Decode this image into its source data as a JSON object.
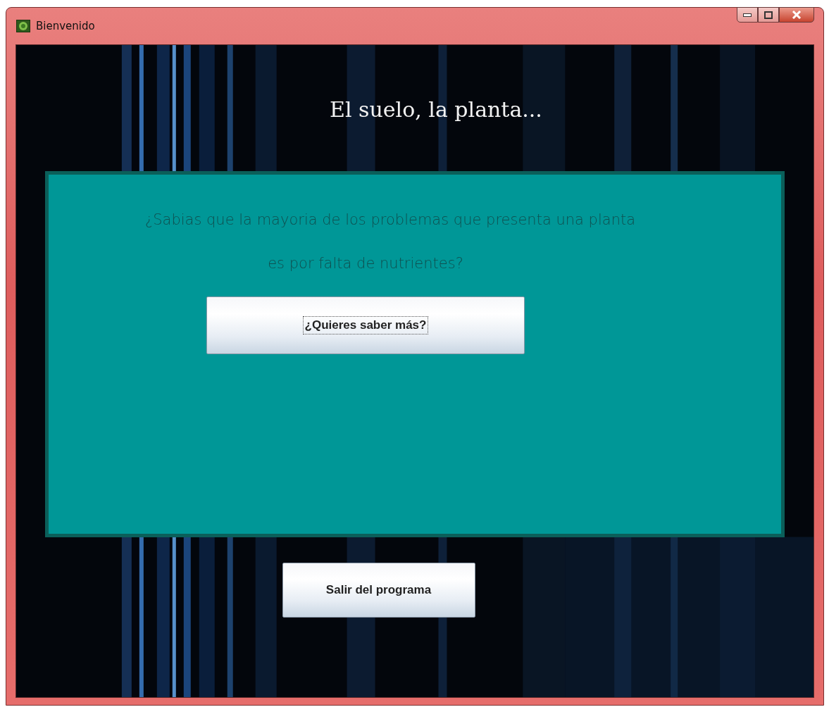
{
  "window": {
    "title": "Bienvenido"
  },
  "heading": "El suelo, la planta...",
  "panel": {
    "lines": [
      "¿Sabias que la mayoria de los problemas que presenta una planta",
      "es por falta de nutrientes?"
    ],
    "button": {
      "label": "¿Quieres saber más?",
      "focused": true
    }
  },
  "exit_button": {
    "label": "Salir del programa",
    "focused": false
  }
}
